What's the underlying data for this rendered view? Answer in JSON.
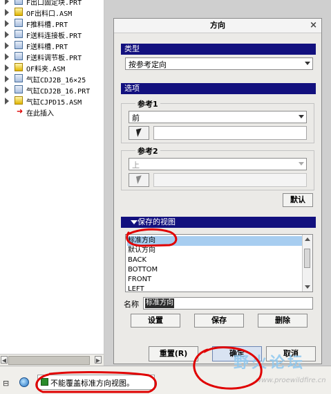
{
  "model_tree": {
    "items": [
      {
        "label": "F出口固定块.PRT",
        "icon": "part-icon",
        "expandable": true
      },
      {
        "label": "OF出料口.ASM",
        "icon": "assembly-icon",
        "expandable": true
      },
      {
        "label": "F推料槽.PRT",
        "icon": "part-icon",
        "expandable": true
      },
      {
        "label": "F送料连接板.PRT",
        "icon": "part-icon",
        "expandable": true
      },
      {
        "label": "F送料槽.PRT",
        "icon": "part-icon",
        "expandable": true
      },
      {
        "label": "F送料调节板.PRT",
        "icon": "part-icon",
        "expandable": true
      },
      {
        "label": "OF料夹.ASM",
        "icon": "assembly-icon",
        "expandable": true
      },
      {
        "label": "气缸CDJ2B_16×25",
        "icon": "cylinder-part-icon",
        "expandable": true
      },
      {
        "label": "气缸CDJ2B_16.PRT",
        "icon": "cylinder-part-icon",
        "expandable": true
      },
      {
        "label": "气缸CJPD15.ASM",
        "icon": "cylinder-assembly-icon",
        "expandable": true
      },
      {
        "label": "在此插入",
        "icon": "insert-here-arrow-icon",
        "expandable": false
      }
    ]
  },
  "dialog": {
    "title": "方向",
    "close_glyph": "×",
    "type_section": {
      "header": "类型",
      "selected": "按参考定向"
    },
    "options_section": {
      "header": "选项",
      "reference1": {
        "title": "参考1",
        "selected": "前",
        "field_value": ""
      },
      "reference2": {
        "title": "参考2",
        "selected": "上",
        "field_value": "",
        "disabled": true
      },
      "default_button": "默认"
    },
    "saved_views": {
      "header": "保存的视图",
      "items": [
        "标准方向",
        "默认方向",
        "BACK",
        "BOTTOM",
        "FRONT",
        "LEFT"
      ],
      "selected_index": 0,
      "name_label": "名称",
      "name_value": "标准方向",
      "set_button": "设置",
      "save_button": "保存",
      "delete_button": "删除"
    },
    "reset_button": "重置(R)",
    "ok_button": "确定",
    "cancel_button": "取消"
  },
  "status_bar": {
    "message": "不能覆盖标准方向视图。"
  },
  "watermark": {
    "title": "野火论坛",
    "url": "www.proewildfire.cn"
  },
  "colors": {
    "section_header_bg": "#12107e",
    "selection_bg": "#a7cdf0",
    "annotation_red": "#e00000"
  }
}
